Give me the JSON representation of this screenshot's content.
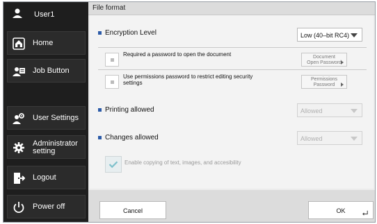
{
  "sidebar": {
    "user": "User1",
    "items": [
      {
        "label": "Home",
        "icon": "home-icon"
      },
      {
        "label": "Job Button",
        "icon": "job-button-icon"
      },
      {
        "label": "User Settings",
        "icon": "user-settings-icon"
      },
      {
        "label_line1": "Administrator",
        "label_line2": "setting",
        "icon": "admin-gear-icon"
      },
      {
        "label": "Logout",
        "icon": "logout-icon"
      },
      {
        "label": "Power off",
        "icon": "power-icon"
      }
    ]
  },
  "main": {
    "title": "File format",
    "encryption": {
      "label": "Encryption Level",
      "value": "Low (40–bit RC4)"
    },
    "open_password": {
      "label": "Required a password to open the document",
      "button_line1": "Document",
      "button_line2": "Open Password"
    },
    "permissions_password": {
      "label_line1": "Use permissions password to restrict editing security",
      "label_line2": "settings",
      "button_line1": "Permissions",
      "button_line2": "Password"
    },
    "printing": {
      "label": "Printing allowed",
      "value": "Allowed"
    },
    "changes": {
      "label": "Changes allowed",
      "value": "Allowed"
    },
    "copying": {
      "label": "Enable copying of text, images, and accesibility"
    }
  },
  "footer": {
    "cancel": "Cancel",
    "ok": "OK"
  },
  "colors": {
    "sidebar": "#1e1e1e",
    "accent_square": "#2b5aa8",
    "check": "#49a7b9"
  }
}
